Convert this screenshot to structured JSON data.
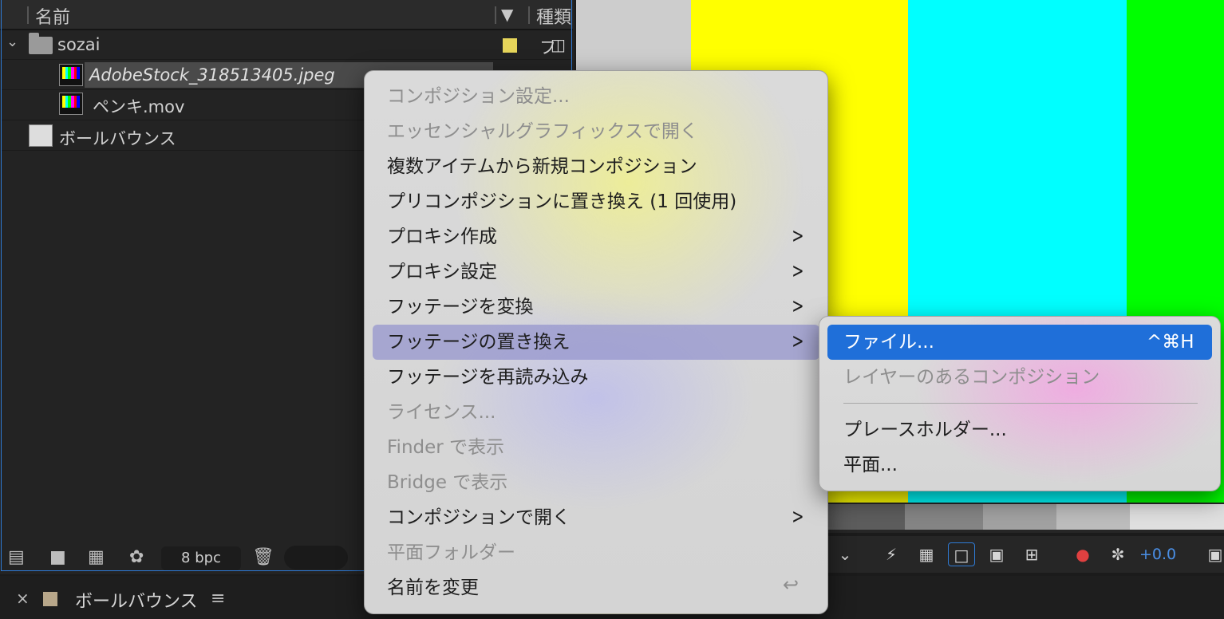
{
  "project_panel": {
    "header": {
      "name_col": "名前",
      "type_col": "種類"
    },
    "rows": [
      {
        "name": "sozai",
        "type_glyph": "フ"
      },
      {
        "name": "AdobeStock_318513405.jpeg"
      },
      {
        "name": "ペンキ.mov"
      },
      {
        "name": "ボールバウンス"
      }
    ],
    "bottom": {
      "bpc": "8 bpc"
    }
  },
  "tab": {
    "close": "×",
    "title": "ボールバウンス",
    "menu": "≡"
  },
  "context_menu": {
    "items": [
      {
        "label": "コンポジション設定..."
      },
      {
        "label": "エッセンシャルグラフィックスで開く"
      },
      {
        "label": "複数アイテムから新規コンポジション"
      },
      {
        "label": "プリコンポジションに置き換え (1 回使用)"
      },
      {
        "label": "プロキシ作成"
      },
      {
        "label": "プロキシ設定"
      },
      {
        "label": "フッテージを変換"
      },
      {
        "label": "フッテージの置き換え"
      },
      {
        "label": "フッテージを再読み込み"
      },
      {
        "label": "ライセンス..."
      },
      {
        "label": "Finder で表示"
      },
      {
        "label": "Bridge で表示"
      },
      {
        "label": "コンポジションで開く"
      },
      {
        "label": "平面フォルダー"
      },
      {
        "label": "名前を変更"
      }
    ],
    "rename_shortcut": "↩"
  },
  "submenu": {
    "items": [
      {
        "label": "ファイル...",
        "shortcut": "^⌘H"
      },
      {
        "label": "レイヤーのあるコンポジション"
      },
      {
        "label": "プレースホルダー..."
      },
      {
        "label": "平面..."
      }
    ]
  },
  "viewer": {
    "exposure": "+0.0",
    "colors": {
      "gray": "#cdcdcd",
      "yellow": "#ffff00",
      "cyan": "#00ffff",
      "green": "#00ff00",
      "accent": "#1f6fd9"
    }
  }
}
